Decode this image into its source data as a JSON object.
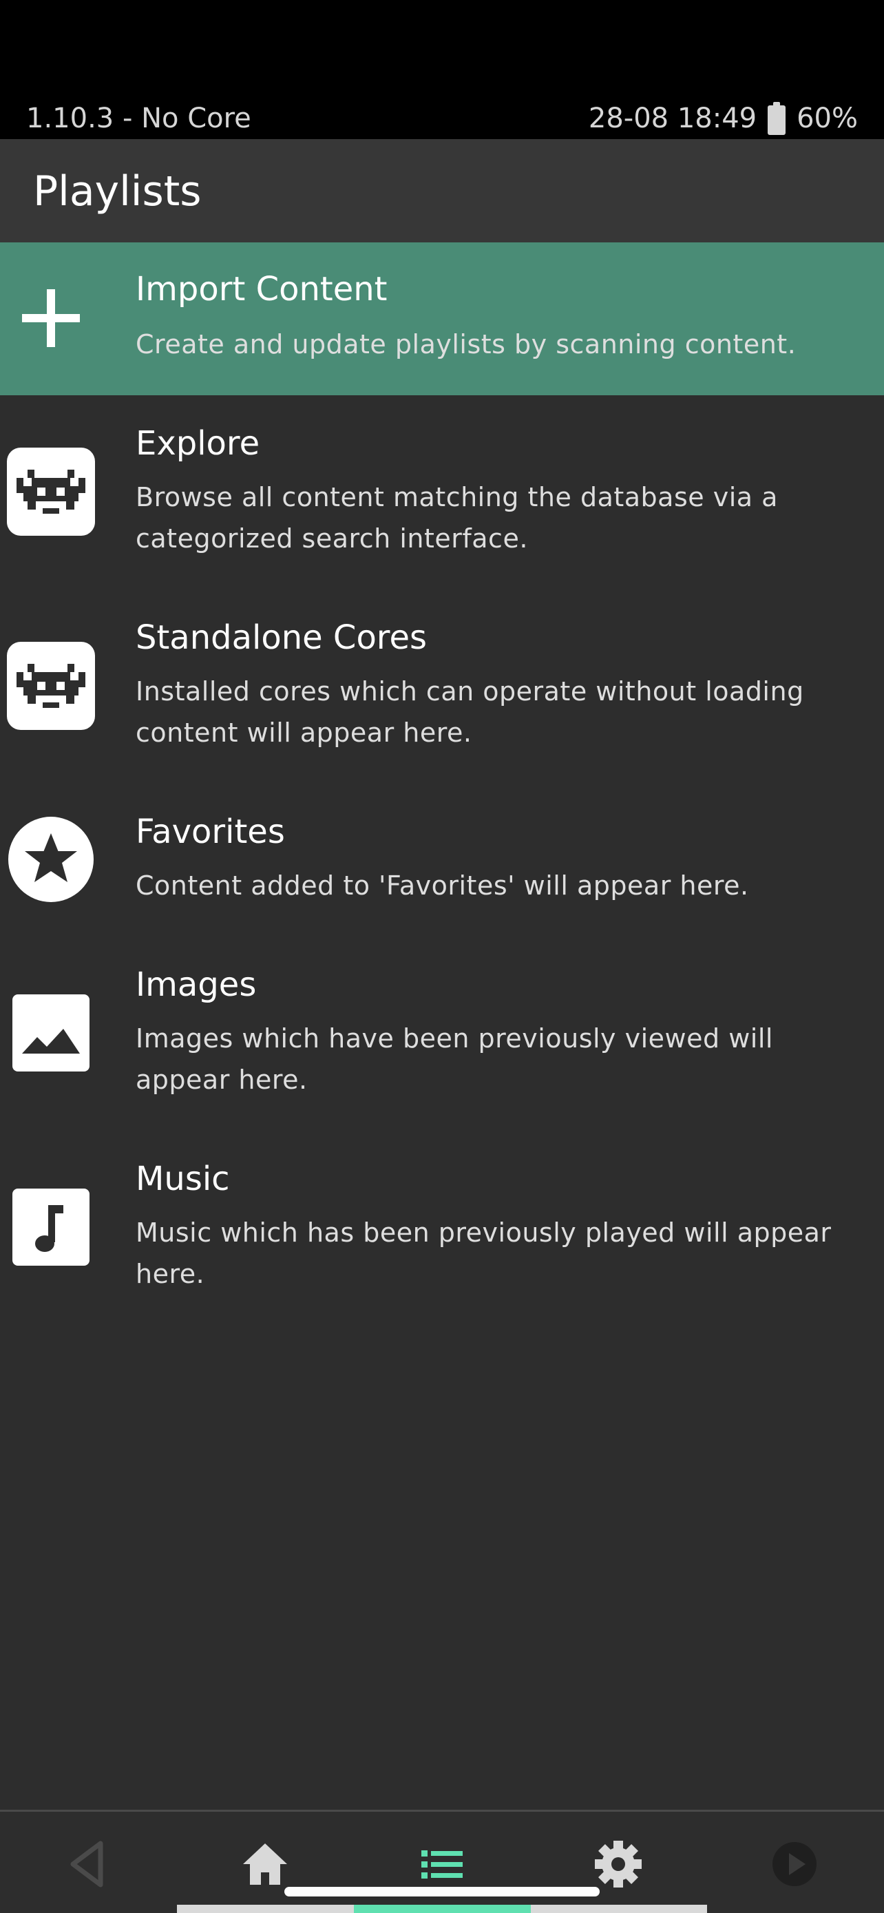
{
  "status_bar": {
    "left_text": "1.10.3 - No Core",
    "datetime": "28-08 18:49",
    "battery_percent": "60%"
  },
  "header": {
    "title": "Playlists"
  },
  "items": [
    {
      "label": "Import Content",
      "sublabel": "Create and update playlists by scanning content.",
      "icon": "plus-icon",
      "selected": true
    },
    {
      "label": "Explore",
      "sublabel": "Browse all content matching the database via a categorized search interface.",
      "icon": "retroarch-invader-icon",
      "selected": false
    },
    {
      "label": "Standalone Cores",
      "sublabel": "Installed cores which can operate without loading content will appear here.",
      "icon": "retroarch-invader-icon",
      "selected": false
    },
    {
      "label": "Favorites",
      "sublabel": "Content added to 'Favorites' will appear here.",
      "icon": "star-icon",
      "selected": false
    },
    {
      "label": "Images",
      "sublabel": "Images which have been previously viewed will appear here.",
      "icon": "image-icon",
      "selected": false
    },
    {
      "label": "Music",
      "sublabel": "Music which has been previously played will appear here.",
      "icon": "music-note-icon",
      "selected": false
    }
  ],
  "bottom_nav": {
    "buttons": [
      {
        "name": "back",
        "icon": "back-triangle-icon"
      },
      {
        "name": "main-menu",
        "icon": "home-icon"
      },
      {
        "name": "playlists",
        "icon": "list-icon",
        "active": true
      },
      {
        "name": "settings",
        "icon": "gear-icon"
      },
      {
        "name": "resume",
        "icon": "play-circle-icon"
      }
    ]
  },
  "colors": {
    "accent": "#5fe0b0",
    "selected_row": "#4a8c76",
    "background": "#2d2d2d",
    "header": "#373737"
  }
}
